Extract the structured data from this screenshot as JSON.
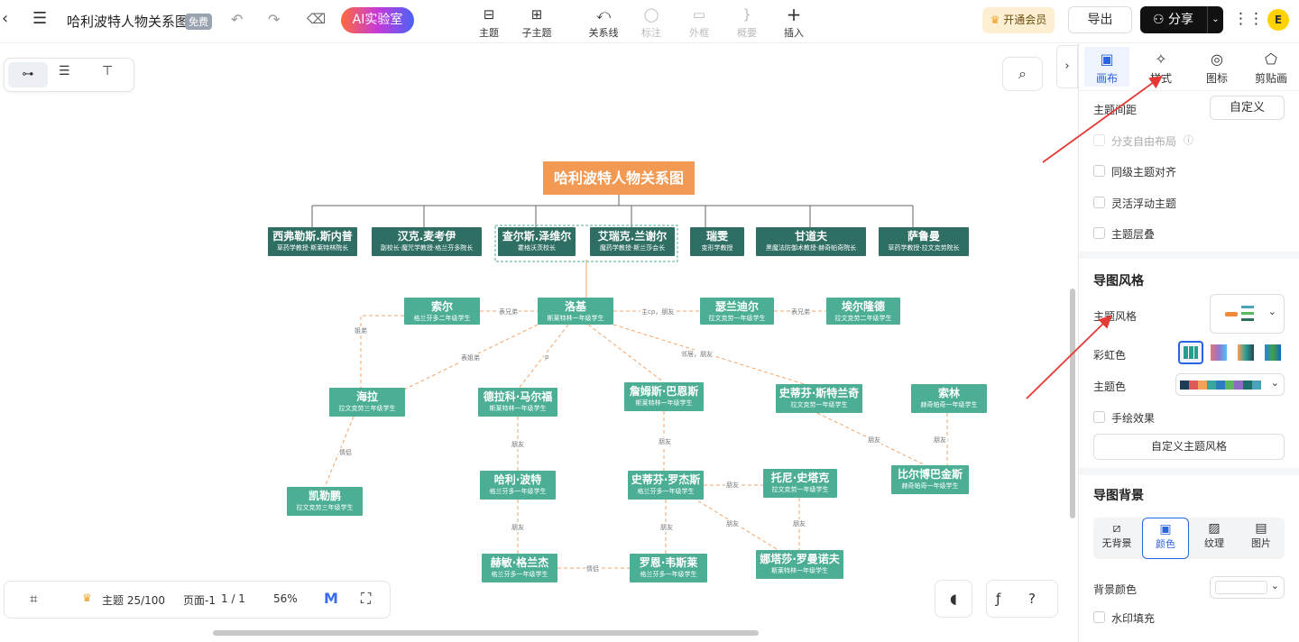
{
  "header": {
    "back_icon": "back-arrow-icon",
    "menu_icon": "hamburger-icon",
    "doc_title": "哈利波特人物关系图",
    "free_badge": "免费",
    "ai_button": "AI实验室",
    "tools": [
      {
        "label": "主题",
        "icon": "topic-icon"
      },
      {
        "label": "子主题",
        "icon": "subtopic-icon"
      },
      {
        "label": "关系线",
        "icon": "relation-icon"
      },
      {
        "label": "标注",
        "icon": "comment-icon"
      },
      {
        "label": "外框",
        "icon": "frame-icon"
      },
      {
        "label": "概要",
        "icon": "summary-icon"
      },
      {
        "label": "插入",
        "icon": "plus-icon"
      }
    ],
    "vip_button": "开通会员",
    "export_button": "导出",
    "share_button": "分享",
    "avatar_letter": "E"
  },
  "panel": {
    "tabs": [
      {
        "label": "画布",
        "icon": "canvas-icon"
      },
      {
        "label": "样式",
        "icon": "style-icon"
      },
      {
        "label": "图标",
        "icon": "marker-icon"
      },
      {
        "label": "剪贴画",
        "icon": "clipart-icon"
      }
    ],
    "topic_spacing_label": "主题间距",
    "custom_button": "自定义",
    "checkboxes_top": [
      "分支自由布局",
      "同级主题对齐",
      "灵活浮动主题",
      "主题层叠"
    ],
    "style_section": "导图风格",
    "theme_style_label": "主题风格",
    "rainbow_label": "彩虹色",
    "theme_color_label": "主题色",
    "hand_drawn_label": "手绘效果",
    "custom_theme_button": "自定义主题风格",
    "bg_section": "导图背景",
    "bg_options": [
      "无背景",
      "颜色",
      "纹理",
      "图片"
    ],
    "bg_color_label": "背景颜色",
    "watermark_label": "水印填充",
    "palette": [
      "#1f3b5a",
      "#e05a5a",
      "#f2a05a",
      "#3aa6a0",
      "#2b7bbd",
      "#5cb85c",
      "#8d6cc4",
      "#1f6e6e",
      "#4aa3b8"
    ]
  },
  "bottombar": {
    "topic_count": "主题 25/100",
    "page_label": "页面-1",
    "page_count": "1 / 1",
    "zoom": "56%"
  },
  "map": {
    "root": "哈利波特人物关系图",
    "top_nodes": [
      {
        "name": "西弗勒斯.斯内普",
        "sub": "草药学教授·斯莱特林院长"
      },
      {
        "name": "汉克.麦考伊",
        "sub": "副校长·魔咒学教授·格兰芬多院长"
      },
      {
        "name": "查尔斯.泽维尔",
        "sub": "霍格沃茨校长"
      },
      {
        "name": "艾瑞克.兰谢尔",
        "sub": "魔药学教授·斯兰莎会长"
      },
      {
        "name": "瑞雯",
        "sub": "变形学教授"
      },
      {
        "name": "甘道夫",
        "sub": "黑魔法防御术教授·赫奇帕奇院长"
      },
      {
        "name": "萨鲁曼",
        "sub": "草药学教授·拉文克劳院长"
      }
    ],
    "students": [
      {
        "name": "索尔",
        "sub": "格兰芬多二年级学生"
      },
      {
        "name": "洛基",
        "sub": "斯莱特林一年级学生"
      },
      {
        "name": "瑟兰迪尔",
        "sub": "拉文克劳一年级学生"
      },
      {
        "name": "埃尔隆德",
        "sub": "拉文克劳二年级学生"
      },
      {
        "name": "海拉",
        "sub": "拉文克劳三年级学生"
      },
      {
        "name": "德拉科·马尔福",
        "sub": "斯莱特林一年级学生"
      },
      {
        "name": "詹姆斯·巴恩斯",
        "sub": "斯莱特林一年级学生"
      },
      {
        "name": "史蒂芬·斯特兰奇",
        "sub": "拉文克劳一年级学生"
      },
      {
        "name": "索林",
        "sub": "赫奇帕奇一年级学生"
      },
      {
        "name": "凯勒鹏",
        "sub": "拉文克劳三年级学生"
      },
      {
        "name": "哈利·波特",
        "sub": "格兰芬多一年级学生"
      },
      {
        "name": "史蒂芬·罗杰斯",
        "sub": "格兰芬多一年级学生"
      },
      {
        "name": "托尼·史塔克",
        "sub": "拉文克劳一年级学生"
      },
      {
        "name": "比尔博巴金斯",
        "sub": "赫奇帕奇一年级学生"
      },
      {
        "name": "赫敏·格兰杰",
        "sub": "格兰芬多一年级学生"
      },
      {
        "name": "罗恩·韦斯莱",
        "sub": "格兰芬多一年级学生"
      },
      {
        "name": "娜塔莎·罗曼诺夫",
        "sub": "斯莱特林一年级学生"
      }
    ],
    "edge_labels": [
      "表兄弟",
      "主cp，朋友",
      "表兄弟",
      "姐弟",
      "表姐弟",
      "p",
      "邻居，朋友",
      "情侣",
      "朋友",
      "朋友",
      "朋友",
      "朋友",
      "朋友",
      "朋友",
      "朋友",
      "朋友",
      "情侣",
      "朋友"
    ]
  }
}
